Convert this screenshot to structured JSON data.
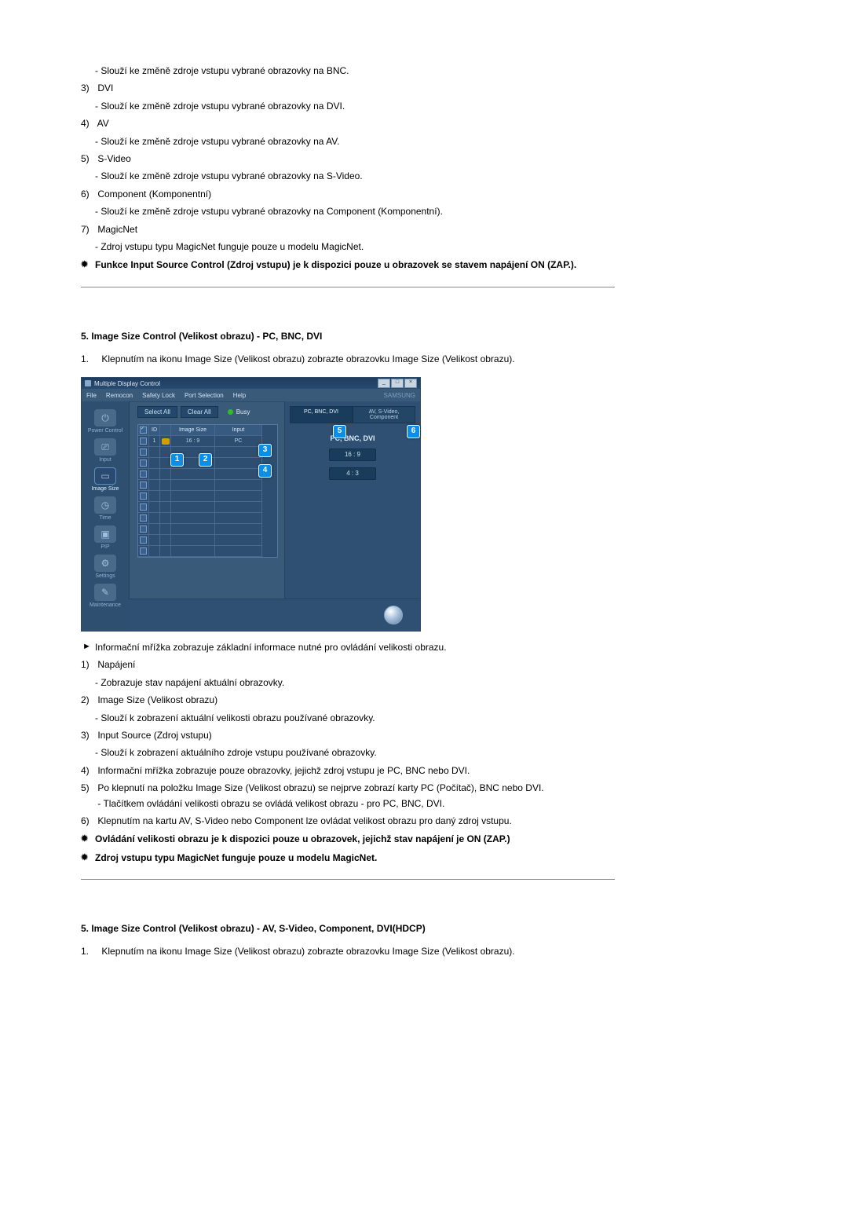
{
  "section1": {
    "items": [
      {
        "num": "3)",
        "label": "DVI",
        "sub": "- Slouží ke změně zdroje vstupu vybrané obrazovky na DVI."
      },
      {
        "num": "4)",
        "label": "AV",
        "sub": "- Slouží ke změně zdroje vstupu vybrané obrazovky na AV."
      },
      {
        "num": "5)",
        "label": "S-Video",
        "sub": "- Slouží ke změně zdroje vstupu vybrané obrazovky na S-Video."
      },
      {
        "num": "6)",
        "label": "Component (Komponentní)",
        "sub": "- Slouží ke změně zdroje vstupu vybrané obrazovky na Component (Komponentní)."
      },
      {
        "num": "7)",
        "label": "MagicNet",
        "sub": "- Zdroj vstupu typu MagicNet funguje pouze u modelu MagicNet."
      }
    ],
    "lead_sub": "- Slouží ke změně zdroje vstupu vybrané obrazovky na BNC.",
    "note": "Funkce Input Source Control (Zdroj vstupu) je k dispozici pouze u obrazovek se stavem napájení ON (ZAP.)."
  },
  "section2": {
    "title": "5. Image Size Control (Velikost obrazu) - PC, BNC, DVI",
    "intro_num": "1.",
    "intro": "Klepnutím na ikonu Image Size (Velikost obrazu) zobrazte obrazovku Image Size (Velikost obrazu).",
    "bullet_lead": "Informační mřížka zobrazuje základní informace nutné pro ovládání velikosti obrazu.",
    "items": [
      {
        "num": "1)",
        "label": "Napájení",
        "sub": "- Zobrazuje stav napájení aktuální obrazovky."
      },
      {
        "num": "2)",
        "label": "Image Size (Velikost obrazu)",
        "sub": "- Slouží k zobrazení aktuální velikosti obrazu používané obrazovky."
      },
      {
        "num": "3)",
        "label": "Input Source (Zdroj vstupu)",
        "sub": "- Slouží k zobrazení aktuálního zdroje vstupu používané obrazovky."
      },
      {
        "num": "4)",
        "label": "Informační mřížka zobrazuje pouze obrazovky, jejichž zdroj vstupu je PC, BNC nebo DVI."
      },
      {
        "num": "5)",
        "label": "Po klepnutí na položku Image Size (Velikost obrazu) se nejprve zobrazí karty PC (Počítač), BNC nebo DVI.",
        "sub": "- Tlačítkem ovládání velikosti obrazu se ovládá velikost obrazu - pro PC, BNC, DVI."
      },
      {
        "num": "6)",
        "label": "Klepnutím na kartu AV, S-Video nebo Component lze ovládat velikost obrazu pro daný zdroj vstupu."
      }
    ],
    "notes": [
      "Ovládání velikosti obrazu je k dispozici pouze u obrazovek, jejichž stav napájení je ON (ZAP.)",
      "Zdroj vstupu typu MagicNet funguje pouze u modelu MagicNet."
    ]
  },
  "section3": {
    "title": "5. Image Size Control (Velikost obrazu) - AV, S-Video, Component, DVI(HDCP)",
    "intro_num": "1.",
    "intro": "Klepnutím na ikonu Image Size (Velikost obrazu) zobrazte obrazovku Image Size (Velikost obrazu)."
  },
  "app": {
    "title": "Multiple Display Control",
    "menus": [
      "File",
      "Remocon",
      "Safety Lock",
      "Port Selection",
      "Help"
    ],
    "brand": "SAMSUNG",
    "side": [
      {
        "label": "Power Control",
        "glyph": "⏻"
      },
      {
        "label": "Input",
        "glyph": "⎚"
      },
      {
        "label": "Image Size",
        "glyph": "▭",
        "active": true
      },
      {
        "label": "Time",
        "glyph": "◷"
      },
      {
        "label": "PIP",
        "glyph": "▣"
      },
      {
        "label": "Settings",
        "glyph": "⚙"
      },
      {
        "label": "Maintenance",
        "glyph": "✎"
      }
    ],
    "tabs": [
      "Select All",
      "Clear All"
    ],
    "busy": "Busy",
    "grid_head": [
      "",
      "ID",
      "",
      "Image Size",
      "Input"
    ],
    "grid_row": [
      "",
      "1",
      "",
      "16 : 9",
      "PC"
    ],
    "right_tabs": [
      "PC, BNC, DVI",
      "AV, S-Video, Component"
    ],
    "right_title": "PC, BNC, DVI",
    "slot1": "16 : 9",
    "slot2": "4 : 3",
    "callouts": [
      "1",
      "2",
      "3",
      "4",
      "5",
      "6"
    ]
  }
}
